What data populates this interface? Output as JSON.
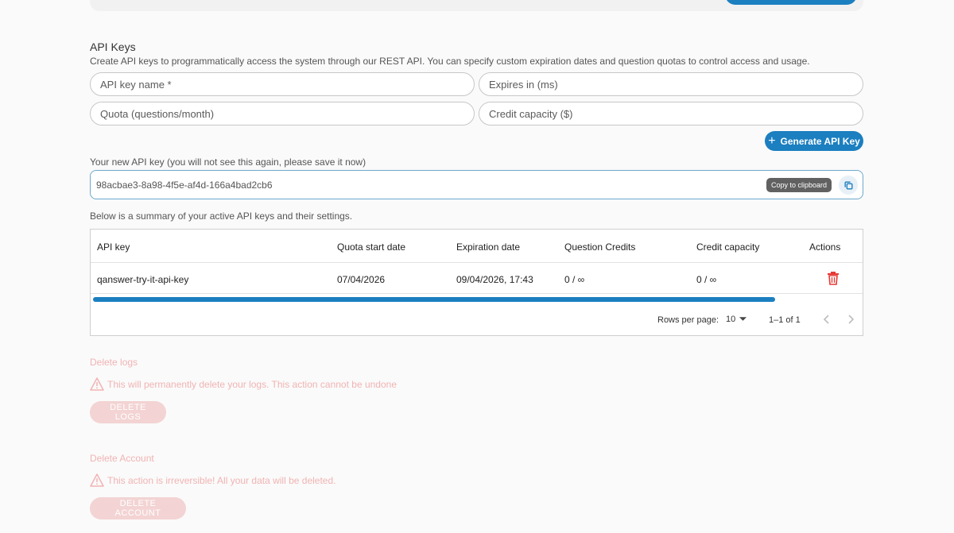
{
  "api_keys": {
    "title": "API Keys",
    "description": "Create API keys to programmatically access the system through our REST API. You can specify custom expiration dates and question quotas to control access and usage.",
    "fields": {
      "name_placeholder": "API key name *",
      "expires_placeholder": "Expires in (ms)",
      "quota_placeholder": "Quota (questions/month)",
      "credit_placeholder": "Credit capacity ($)"
    },
    "generate_button": "Generate API Key",
    "new_key_label": "Your new API key (you will not see this again, please save it now)",
    "new_key_value": "98acbae3-8a98-4f5e-af4d-166a4bad2cb6",
    "copy_tooltip": "Copy to clipboard",
    "summary_text": "Below is a summary of your active API keys and their settings.",
    "table": {
      "headers": [
        "API key",
        "Quota start date",
        "Expiration date",
        "Question Credits",
        "Credit capacity",
        "Actions"
      ],
      "rows": [
        [
          "qanswer-try-it-api-key",
          "07/04/2026",
          "09/04/2026, 17:43",
          "0 / ∞",
          "0 / ∞"
        ]
      ],
      "rows_per_page_label": "Rows per page:",
      "rows_per_page_value": "10",
      "range_text": "1–1 of 1"
    }
  },
  "delete_logs": {
    "title": "Delete logs",
    "warning": "This will permanently delete your logs. This action cannot be undone",
    "button": "DELETE LOGS"
  },
  "delete_account": {
    "title": "Delete Account",
    "warning": "This action is irreversible! All your data will be deleted.",
    "button": "DELETE ACCOUNT"
  },
  "colors": {
    "accent": "#1b7fc0",
    "danger_faded": "#f1b3b3",
    "trash": "#e53935"
  },
  "icons": [
    "plus-icon",
    "copy-icon",
    "trash-icon",
    "chevron-left-icon",
    "chevron-right-icon",
    "dropdown-arrow-icon",
    "warning-icon"
  ]
}
